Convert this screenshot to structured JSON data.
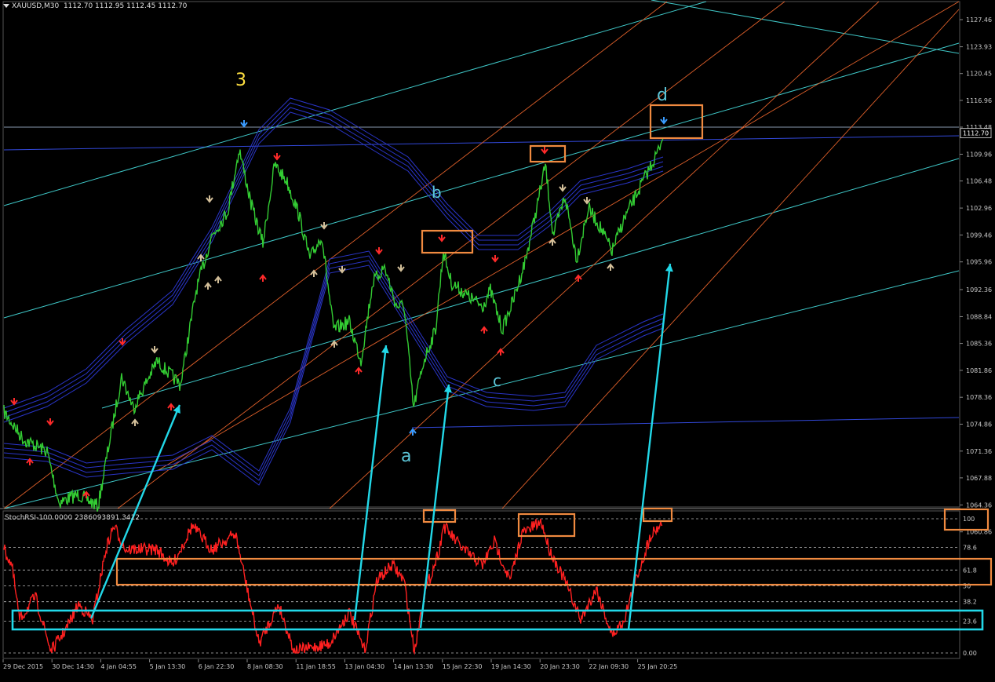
{
  "window": {
    "symbol_label": "XAUUSD,M30",
    "ohlc": "1112.70 1112.95 1112.45 1112.70",
    "indicator_label": "StochRSI-100.0000 2386093891.3412"
  },
  "price_scale": {
    "ticks": [
      "1127.46",
      "1123.93",
      "1120.45",
      "1116.96",
      "1113.48",
      "1109.96",
      "1106.48",
      "1102.96",
      "1099.46",
      "1095.96",
      "1092.36",
      "1088.84",
      "1085.36",
      "1081.86",
      "1078.36",
      "1074.86",
      "1071.36",
      "1067.88",
      "1064.36",
      "1060.86"
    ],
    "current_price": "1112.70"
  },
  "oscillator_scale": {
    "ticks": [
      "100",
      "78.6",
      "61.8",
      "50",
      "38.2",
      "23.6",
      "0.00"
    ]
  },
  "time_axis": {
    "labels": [
      "29 Dec 2015",
      "30 Dec 14:30",
      "4 Jan 04:55",
      "5 Jan 13:30",
      "6 Jan 22:30",
      "8 Jan 08:30",
      "11 Jan 18:55",
      "13 Jan 04:30",
      "14 Jan 13:30",
      "15 Jan 22:30",
      "19 Jan 14:30",
      "20 Jan 23:30",
      "22 Jan 09:30",
      "25 Jan 20:25"
    ]
  },
  "annotations": {
    "wave_3": "3",
    "wave_a": "a",
    "wave_b": "b",
    "wave_c": "c",
    "wave_d": "d"
  },
  "colors": {
    "background": "#000000",
    "price": "#33cc33",
    "oscillator": "#ff2020",
    "channel_cyan": "#3fc8c8",
    "channel_orange": "#e0602a",
    "bands": "#2a35c8",
    "highlight_box": "#f08a40",
    "arrow": "#22d8e8",
    "wave_label_3": "#ffe040",
    "wave_label_other": "#5cc6d8"
  }
}
